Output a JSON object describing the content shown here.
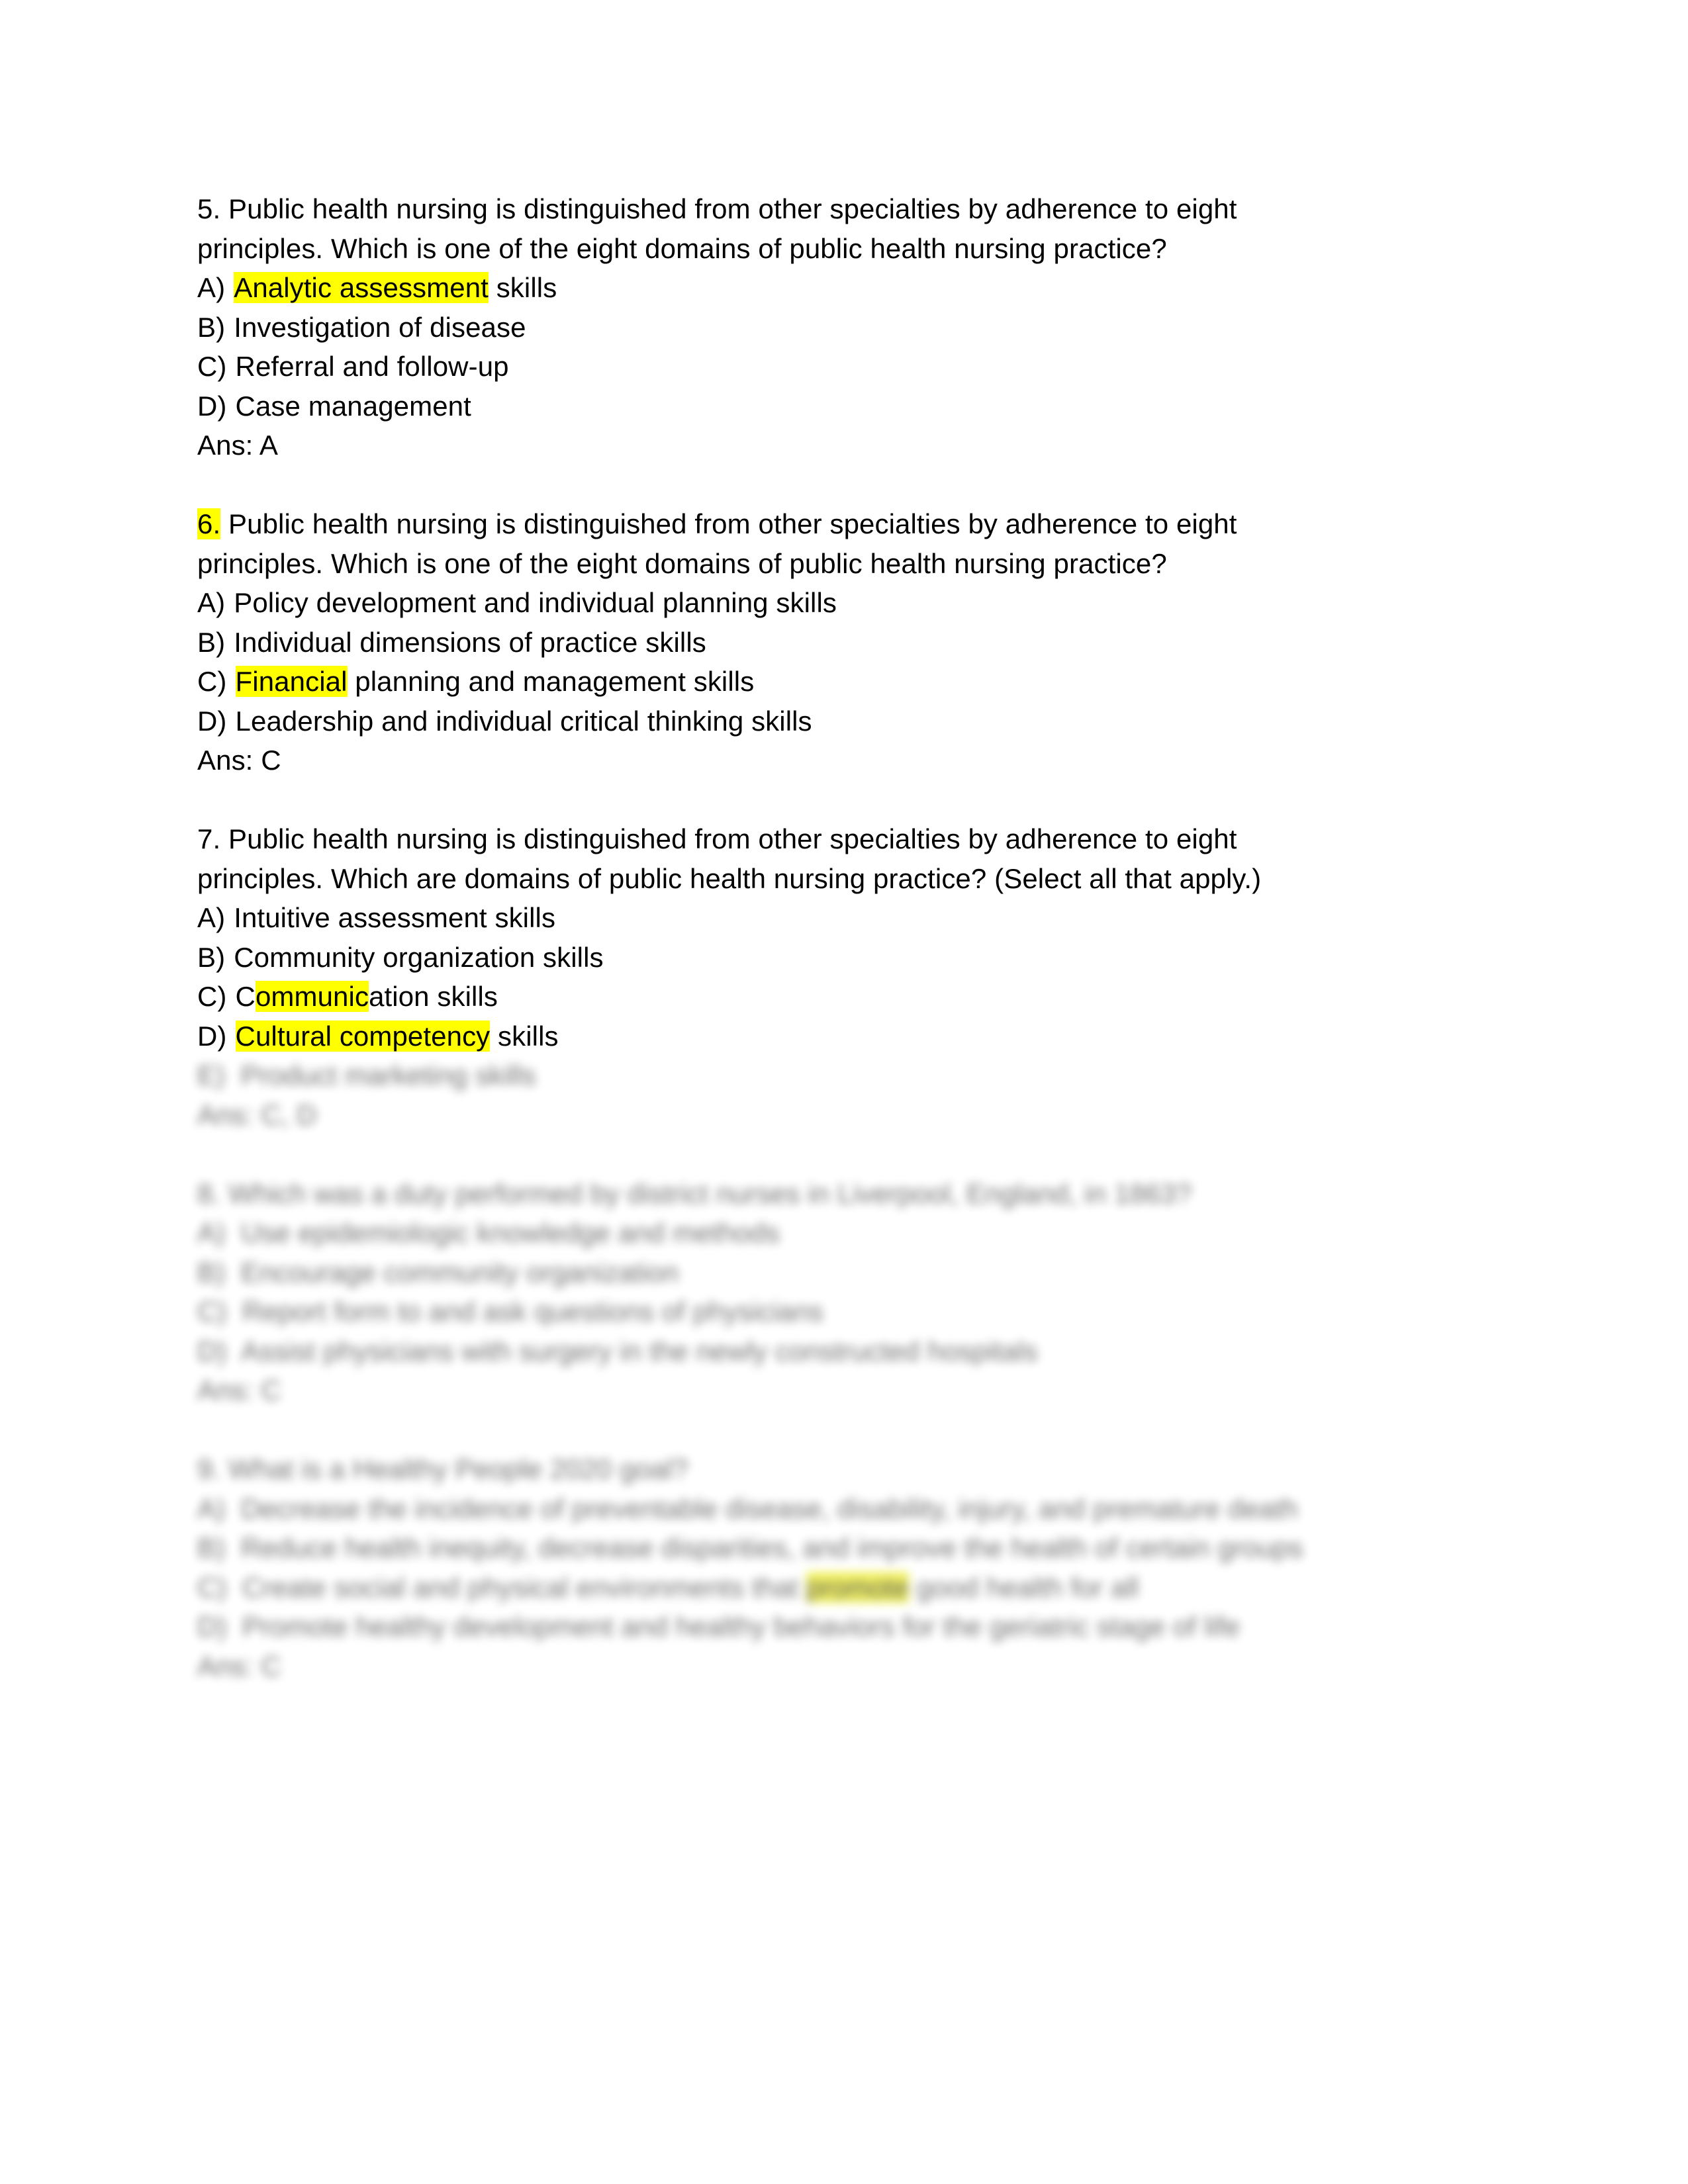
{
  "document": {
    "highlight_color": "#ffff00",
    "text_color": "#000000",
    "page_background": "#ffffff",
    "blocks": [
      {
        "id": "q5",
        "visible": true,
        "number": "5.",
        "number_highlighted": false,
        "stem_line_1": "5. Public health nursing is distinguished from other specialties by adherence to eight",
        "stem_line_2": "principles. Which is one of the eight domains of public health nursing practice?",
        "options": [
          {
            "letter": "A)",
            "pre": "",
            "hl": "Analytic assessment",
            "post": " skills"
          },
          {
            "letter": "B)",
            "pre": "Investigation of disease",
            "hl": "",
            "post": ""
          },
          {
            "letter": "C)",
            "pre": "Referral and follow-up",
            "hl": "",
            "post": ""
          },
          {
            "letter": "D)",
            "pre": "Case management",
            "hl": "",
            "post": ""
          }
        ],
        "answer": "Ans: A"
      },
      {
        "id": "q6",
        "visible": true,
        "number": "6.",
        "number_highlighted": true,
        "stem_line_1_rest": " Public health nursing is distinguished from other specialties by adherence to eight",
        "stem_line_2": "principles. Which is one of the eight domains of public health nursing practice?",
        "options": [
          {
            "letter": "A)",
            "pre": "Policy development and individual planning skills",
            "hl": "",
            "post": ""
          },
          {
            "letter": "B)",
            "pre": "Individual dimensions of practice skills",
            "hl": "",
            "post": ""
          },
          {
            "letter": "C)",
            "pre": "",
            "hl": "Financial",
            "post": " planning and management skills"
          },
          {
            "letter": "D)",
            "pre": "Leadership and individual critical thinking skills",
            "hl": "",
            "post": ""
          }
        ],
        "answer": "Ans: C"
      },
      {
        "id": "q7",
        "visible": true,
        "number": "7.",
        "number_highlighted": false,
        "stem_line_1": "7. Public health nursing is distinguished from other specialties by adherence to eight",
        "stem_line_2": "principles. Which are domains of public health nursing practice? (Select all that apply.)",
        "options": [
          {
            "letter": "A)",
            "pre": "Intuitive assessment skills",
            "hl": "",
            "post": ""
          },
          {
            "letter": "B)",
            "pre": "Community organization skills",
            "hl": "",
            "post": ""
          },
          {
            "letter": "C)",
            "pre": "C",
            "hl": "ommunic",
            "post": "ation skills"
          },
          {
            "letter": "D)",
            "pre": "",
            "hl": "Cultural competency",
            "post": " skills"
          }
        ],
        "answer": ""
      }
    ],
    "blurred_blocks": [
      {
        "id": "q7-tail",
        "lines": [
          {
            "text": "E)  Product marketing skills",
            "hl": "",
            "width_hint": "short"
          },
          {
            "text": "Ans: C, D",
            "hl": "",
            "width_hint": "tiny"
          }
        ]
      },
      {
        "id": "q8",
        "lines": [
          {
            "text": "8. Which was a duty performed by district nurses in Liverpool, England, in 1863?",
            "hl": "",
            "width_hint": "long"
          },
          {
            "text": "A)  Use epidemiologic knowledge and methods",
            "hl": "",
            "width_hint": "medium"
          },
          {
            "text": "B)  Encourage community organization",
            "hl": "",
            "width_hint": "medium"
          },
          {
            "text": "C)  Report form to and ask questions of physicians",
            "hl": "",
            "width_hint": "medium"
          },
          {
            "text": "D)  Assist physicians with surgery in the newly constructed hospitals",
            "hl": "",
            "width_hint": "long"
          },
          {
            "text": "Ans: C",
            "hl": "",
            "width_hint": "tiny"
          }
        ]
      },
      {
        "id": "q9",
        "lines": [
          {
            "text": "9. What is a Healthy People 2020 goal?",
            "hl": "",
            "width_hint": "medium"
          },
          {
            "text": "A)  Decrease the incidence of preventable disease, disability, injury, and premature death",
            "hl": "",
            "width_hint": "full"
          },
          {
            "text": "B)  Reduce health inequity, decrease disparities, and improve the health of certain groups",
            "hl": "",
            "width_hint": "full"
          },
          {
            "text": "C)  Create social and physical environments that promote good health for all",
            "hl": "promote",
            "width_hint": "long"
          },
          {
            "text": "D)  Promote healthy development and healthy behaviors for the geriatric stage of life",
            "hl": "",
            "width_hint": "long"
          },
          {
            "text": "Ans: C",
            "hl": "",
            "width_hint": "tiny"
          }
        ]
      }
    ]
  }
}
